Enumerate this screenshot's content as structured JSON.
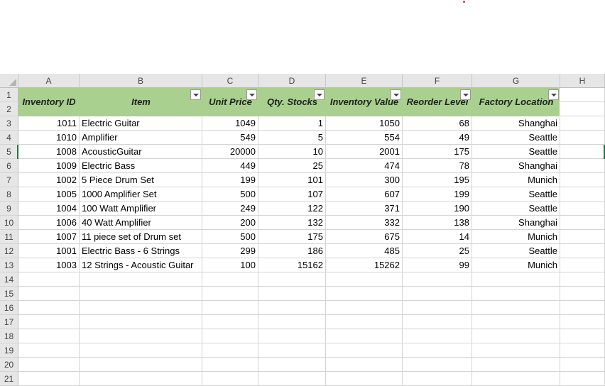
{
  "columns": [
    "A",
    "B",
    "C",
    "D",
    "E",
    "F",
    "G",
    "H"
  ],
  "headers": [
    "Inventory ID",
    "Item",
    "Unit Price",
    "Qty. Stocks",
    "Inventory Value",
    "Reorder Level",
    "Factory Location"
  ],
  "rows": [
    [
      "1011",
      "Electric Guitar",
      "1049",
      "1",
      "1050",
      "68",
      "Shanghai"
    ],
    [
      "1010",
      "Amplifier",
      "549",
      "5",
      "554",
      "49",
      "Seattle"
    ],
    [
      "1008",
      "AcousticGuitar",
      "20000",
      "10",
      "2001",
      "175",
      "Seattle"
    ],
    [
      "1009",
      "Electric Bass",
      "449",
      "25",
      "474",
      "78",
      "Shanghai"
    ],
    [
      "1002",
      "5 Piece Drum Set",
      "199",
      "101",
      "300",
      "195",
      "Munich"
    ],
    [
      "1005",
      "1000 Amplifier Set",
      "500",
      "107",
      "607",
      "199",
      "Seattle"
    ],
    [
      "1004",
      "100 Watt Amplifier",
      "249",
      "122",
      "371",
      "190",
      "Seattle"
    ],
    [
      "1006",
      "40 Watt Amplifier",
      "200",
      "132",
      "332",
      "138",
      "Shanghai"
    ],
    [
      "1007",
      "11 piece set of Drum set",
      "500",
      "175",
      "675",
      "14",
      "Munich"
    ],
    [
      "1001",
      "Electric Bass - 6 Strings",
      "299",
      "186",
      "485",
      "25",
      "Seattle"
    ],
    [
      "1003",
      "12 Strings - Acoustic Guitar",
      "100",
      "15162",
      "15262",
      "99",
      "Munich"
    ]
  ],
  "row_numbers": [
    "1",
    "2",
    "3",
    "4",
    "5",
    "6",
    "7",
    "8",
    "9",
    "10",
    "11",
    "12",
    "13",
    "14",
    "15",
    "16",
    "17",
    "18",
    "19",
    "20",
    "21"
  ],
  "colors": {
    "header_fill": "#a9d08e",
    "grid_line": "#d4d4d4",
    "heading_bg": "#e6e6e6",
    "selection": "#217346"
  }
}
